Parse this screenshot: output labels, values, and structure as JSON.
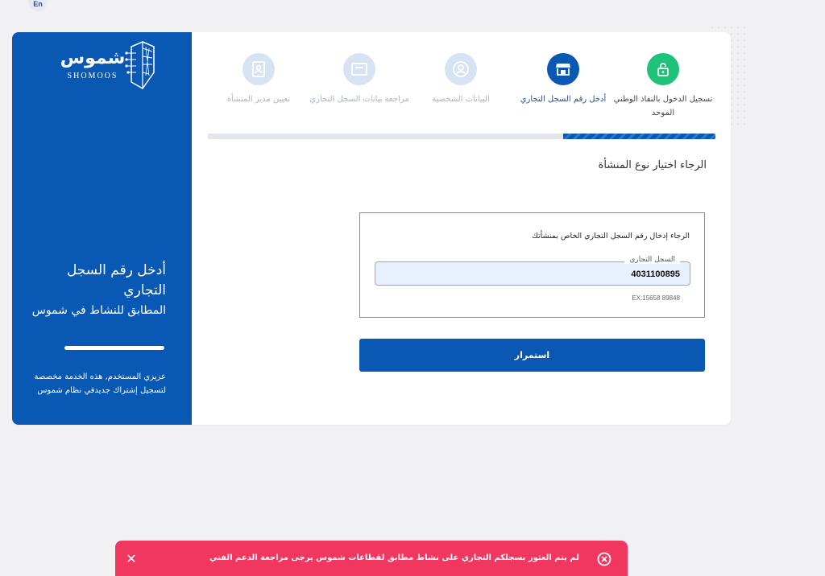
{
  "lang_toggle": "En",
  "brand": {
    "name_ar": "شموس",
    "name_en": "SHOMOOS"
  },
  "sidebar": {
    "title": "أدخل رقم السجل التجاري",
    "subtitle": "المطابق للنشاط في شموس",
    "note": "عزيزي المستخدم, هذه الخدمة مخصصة لتسجيل إشتراك جديدفي نظام شموس"
  },
  "steps": [
    {
      "label": "تسجيل الدخول بالنفاذ الوطني الموحد",
      "status": "completed",
      "icon": "lock-icon"
    },
    {
      "label": "أدخل رقم السجل التجاري",
      "status": "active",
      "icon": "store-icon"
    },
    {
      "label": "البيانات الشخصية",
      "status": "pending",
      "icon": "user-icon"
    },
    {
      "label": "مراجعة بيانات السجل التجاري",
      "status": "pending",
      "icon": "document-icon"
    },
    {
      "label": "تعيين مدير المنشأة",
      "status": "pending",
      "icon": "id-card-icon"
    }
  ],
  "progress_fraction": 0.3,
  "main": {
    "prompt_title": "الرجاء اختيار نوع المنشأة",
    "form_label": "الرجاء إدخال رقم السجل التجاري الخاص بمنشأتك",
    "cr_field": {
      "legend": "السجل التجاري",
      "value": "4031100895",
      "hint": "EX:15658 89848"
    },
    "continue_label": "استمرار"
  },
  "toast": {
    "message": "لم يتم العثور بسجلكم التجاري على نشاط مطابق لقطاعات شموس يرجى مراجعة الدعم الفني",
    "close_glyph": "✕"
  },
  "colors": {
    "brand_blue": "#0858b4",
    "success_green": "#1ec279",
    "pending_step": "#d7e3f3",
    "toast_red": "#f1365f"
  }
}
